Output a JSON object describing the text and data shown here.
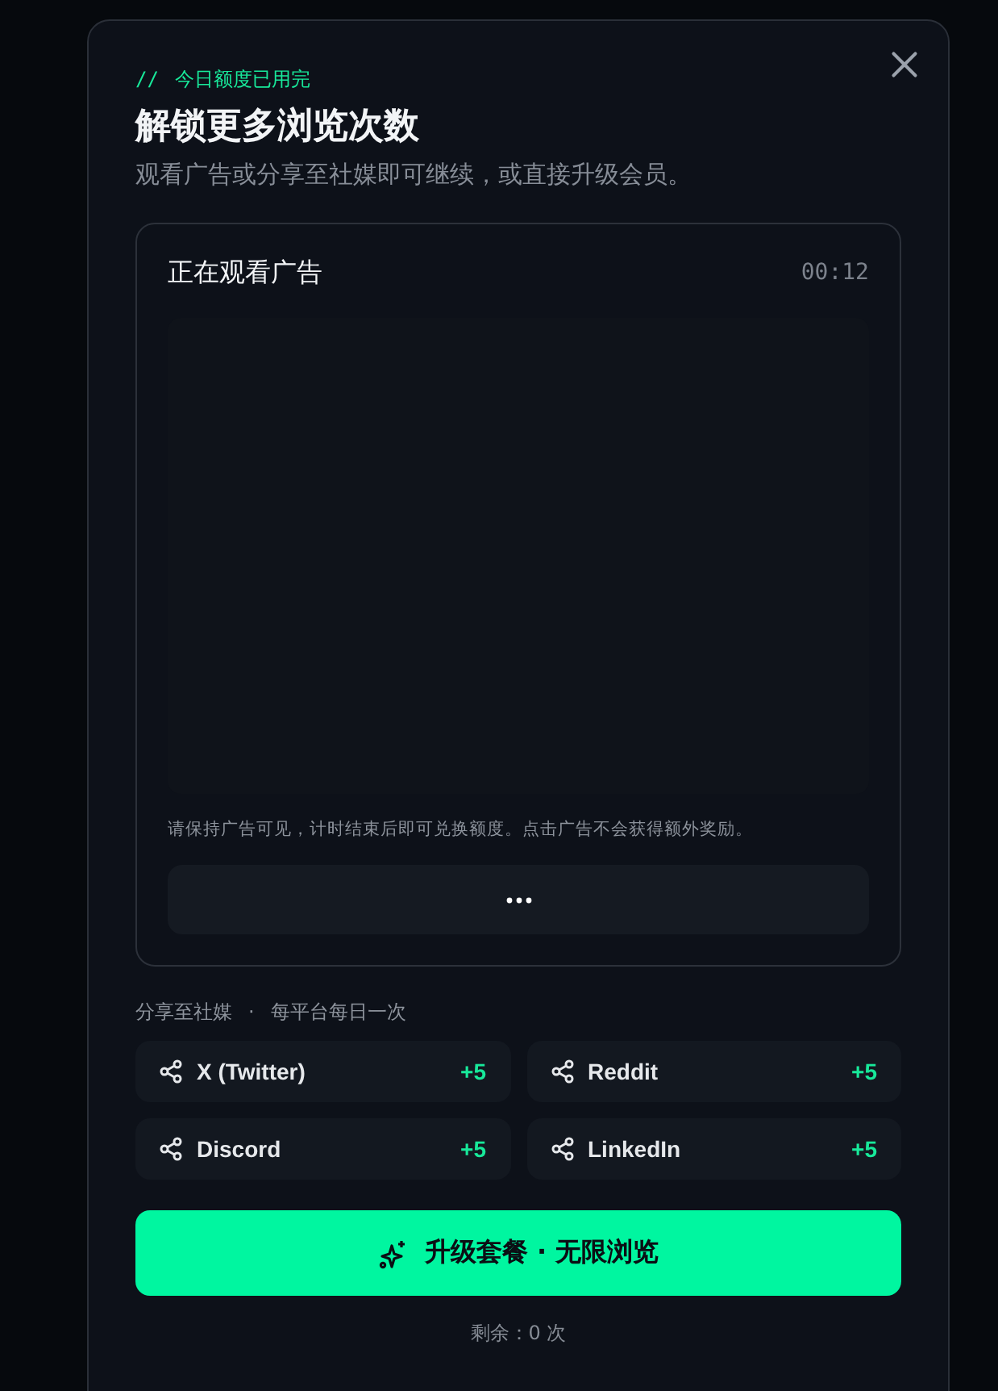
{
  "eyebrow": {
    "mark": "//",
    "text": "今日额度已用完"
  },
  "title": "解锁更多浏览次数",
  "subtitle": "观看广告或分享至社媒即可继续，或直接升级会员。",
  "ad": {
    "title": "正在观看广告",
    "timer": "00:12",
    "note": "请保持广告可见，计时结束后即可兑换额度。点击广告不会获得额外奖励。"
  },
  "share": {
    "label": "分享至社媒",
    "separator": "·",
    "hint": "每平台每日一次",
    "platforms": [
      {
        "name": "X (Twitter)",
        "bonus": "+5"
      },
      {
        "name": "Reddit",
        "bonus": "+5"
      },
      {
        "name": "Discord",
        "bonus": "+5"
      },
      {
        "name": "LinkedIn",
        "bonus": "+5"
      }
    ]
  },
  "upgrade": {
    "label": "升级套餐 · 无限浏览"
  },
  "remaining": "剩余：0 次"
}
